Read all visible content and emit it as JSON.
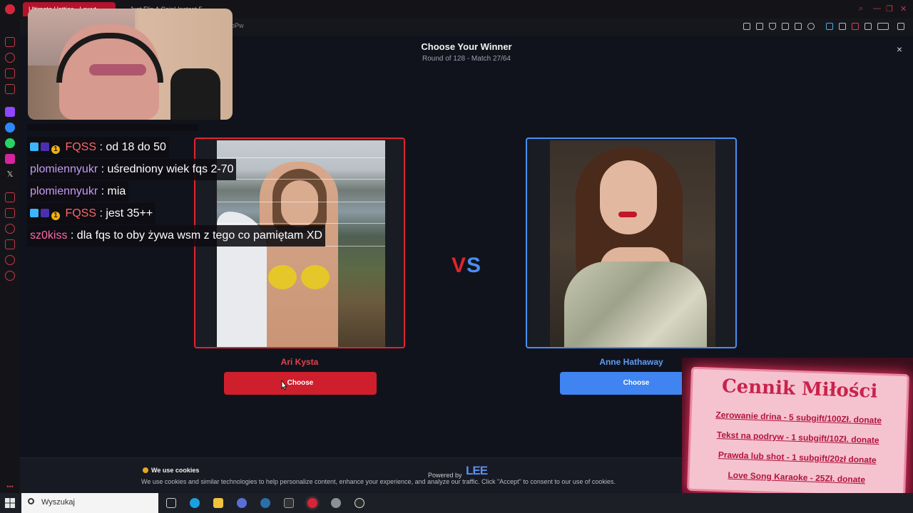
{
  "browser": {
    "tabs": [
      {
        "label": "Ultimate Hotties - Lowyt..."
      },
      {
        "label": "Just Flip A Coin! Instant 5..."
      }
    ],
    "url_fragment": "oPw"
  },
  "page": {
    "title": "Choose Your Winner",
    "subtitle": "Round of 128 - Match 27/64",
    "close_glyph": "×",
    "vs_v": "V",
    "vs_s": "S",
    "left_candidate": {
      "name": "Ari Kysta",
      "button": "Choose"
    },
    "right_candidate": {
      "name": "Anne Hathaway",
      "button": "Choose"
    }
  },
  "cookie": {
    "title": "We use cookies",
    "text": "We use cookies and similar technologies to help personalize content, enhance your experience, and analyze our traffic. Click \"Accept\" to consent to our use of cookies.",
    "powered_by": "Powered by",
    "logo_text": "LEE"
  },
  "chat": [
    {
      "user": "FQSS",
      "message": " : od 18 do 50",
      "badges": true,
      "color": "red"
    },
    {
      "user": "plomiennyukr",
      "message": " : uśredniony wiek fqs 2-70",
      "badges": false,
      "color": "purple"
    },
    {
      "user": "plomiennyukr",
      "message": " : mia",
      "badges": false,
      "color": "purple"
    },
    {
      "user": "FQSS",
      "message": " : jest 35++",
      "badges": true,
      "color": "red"
    },
    {
      "user": "sz0kiss",
      "message": " : dla fqs to oby żywa wsm z tego co pamiętam XD",
      "badges": false,
      "color": "pink"
    }
  ],
  "badge_one": "1",
  "price_card": {
    "title": "Cennik Miłości",
    "lines": [
      "Zerowanie drina - 5 subgift/100Zł. donate",
      "Tekst na podryw - 1 subgift/10Zł. donate",
      "Prawda lub shot - 1 subgift/20zł donate",
      "Love Song Karaoke - 25Zł. donate"
    ]
  },
  "taskbar": {
    "search_placeholder": "Wyszukaj"
  },
  "colors": {
    "accent_red": "#e0242f",
    "accent_blue": "#4a8ff0"
  }
}
